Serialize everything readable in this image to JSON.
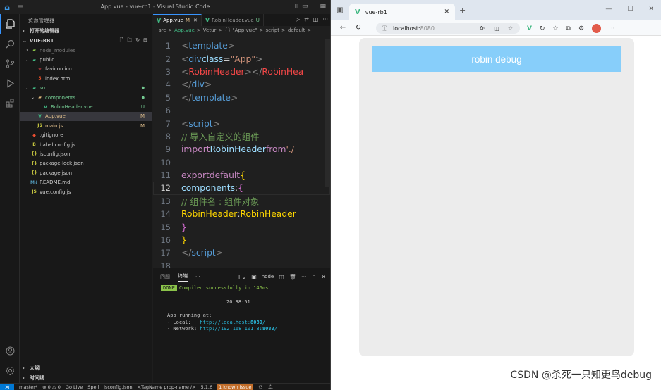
{
  "vscode": {
    "title": "App.vue - vue-rb1 - Visual Studio Code",
    "sidebar": {
      "header": "资源管理器",
      "open_editors": "打开的编辑器",
      "project": "VUE-RB1",
      "outline": "大纲",
      "timeline": "时间线",
      "tree": [
        {
          "label": "node_modules",
          "kind": "folder",
          "status": "",
          "indent": 1
        },
        {
          "label": "public",
          "kind": "folder",
          "status": "",
          "indent": 1,
          "open": true
        },
        {
          "label": "favicon.ico",
          "kind": "ico",
          "status": "",
          "indent": 2
        },
        {
          "label": "index.html",
          "kind": "html",
          "status": "",
          "indent": 2
        },
        {
          "label": "src",
          "kind": "folder",
          "status": "●",
          "indent": 1,
          "open": true
        },
        {
          "label": "components",
          "kind": "folder",
          "status": "●",
          "indent": 2,
          "open": true
        },
        {
          "label": "RobinHeader.vue",
          "kind": "vue",
          "status": "U",
          "indent": 3
        },
        {
          "label": "App.vue",
          "kind": "vue",
          "status": "M",
          "indent": 2
        },
        {
          "label": "main.js",
          "kind": "js",
          "status": "M",
          "indent": 2
        },
        {
          "label": ".gitignore",
          "kind": "git",
          "status": "",
          "indent": 1
        },
        {
          "label": "babel.config.js",
          "kind": "babel",
          "status": "",
          "indent": 1
        },
        {
          "label": "jsconfig.json",
          "kind": "json",
          "status": "",
          "indent": 1
        },
        {
          "label": "package-lock.json",
          "kind": "json",
          "status": "",
          "indent": 1
        },
        {
          "label": "package.json",
          "kind": "json",
          "status": "",
          "indent": 1
        },
        {
          "label": "README.md",
          "kind": "md",
          "status": "",
          "indent": 1
        },
        {
          "label": "vue.config.js",
          "kind": "js",
          "status": "",
          "indent": 1
        }
      ]
    },
    "tabs": [
      {
        "label": "App.vue",
        "mark": "M",
        "active": true
      },
      {
        "label": "RobinHeader.vue",
        "mark": "U",
        "active": false
      }
    ],
    "breadcrumbs": [
      "src",
      ">",
      "App.vue",
      ">",
      "Vetur",
      ">",
      "{} \"App.vue\"",
      ">",
      "script",
      ">",
      "default",
      ">"
    ],
    "line_numbers": [
      "1",
      "2",
      "3",
      "4",
      "5",
      "6",
      "7",
      "8",
      "9",
      "10",
      "11",
      "12",
      "13",
      "14",
      "15",
      "16",
      "17",
      "18"
    ],
    "current_line": "12",
    "code": {
      "l1_open": "<",
      "l1_tag": "template",
      "l1_close": ">",
      "l2_open": "<",
      "l2_tag": "div",
      "l2_attr": "class",
      "l2_eq": "=",
      "l2_val": "\"App\"",
      "l2_close": ">",
      "l3_open": "<",
      "l3_tag": "RobinHeader",
      "l3_mid": "></",
      "l3_tag2": "RobinHea",
      "l4_open": "</",
      "l4_tag": "div",
      "l4_close": ">",
      "l5_open": "</",
      "l5_tag": "template",
      "l5_close": ">",
      "l7_open": "<",
      "l7_tag": "script",
      "l7_close": ">",
      "l8_comment": "// 导入自定义的组件",
      "l9_kw": "import",
      "l9_name": "RobinHeader",
      "l9_from": "from",
      "l9_str": "'./",
      "l11_kw1": "export",
      "l11_kw2": "default",
      "l11_br": "{",
      "l12_prop": "components",
      "l12_colon": ":",
      "l12_br": "{",
      "l13_comment": "// 组件名 : 组件对象",
      "l14_key": "RobinHeader",
      "l14_colon": ":",
      "l14_val": "RobinHeader",
      "l15_br": "}",
      "l16_br": "}",
      "l17_open": "</",
      "l17_tag": "script",
      "l17_close": ">"
    },
    "panel": {
      "tabs": [
        "问题",
        "终端",
        "···"
      ],
      "active_tab": "终端",
      "shell": "node",
      "done_badge": "DONE",
      "compiled": "Compiled successfully in 146ms",
      "time": "20:38:51",
      "running": "App running at:",
      "local_label": "- Local:   ",
      "local_url": "http://localhost:",
      "local_port": "8080",
      "local_slash": "/",
      "network_label": "- Network: ",
      "network_url": "http://192.168.101.8:",
      "network_port": "8080",
      "network_slash": "/"
    },
    "status": {
      "branch": "master*",
      "errors": "⊗ 0 ⚠ 0",
      "golive": "Go Live",
      "spell": "Spell",
      "file": "jsconfig.json",
      "tag": "<TagName prop-name />",
      "version": "5.1.6",
      "issue": "1 known issue"
    }
  },
  "browser": {
    "tab_title": "vue-rb1",
    "address": "localhost:",
    "port": "8080",
    "header_text": "robin debug"
  },
  "watermark": "CSDN @杀死一只知更鸟debug",
  "colors": {
    "header_bg": "#87cefa",
    "app_bg": "#ececec",
    "vue_green": "#41b883",
    "accent": "#3794ff"
  }
}
